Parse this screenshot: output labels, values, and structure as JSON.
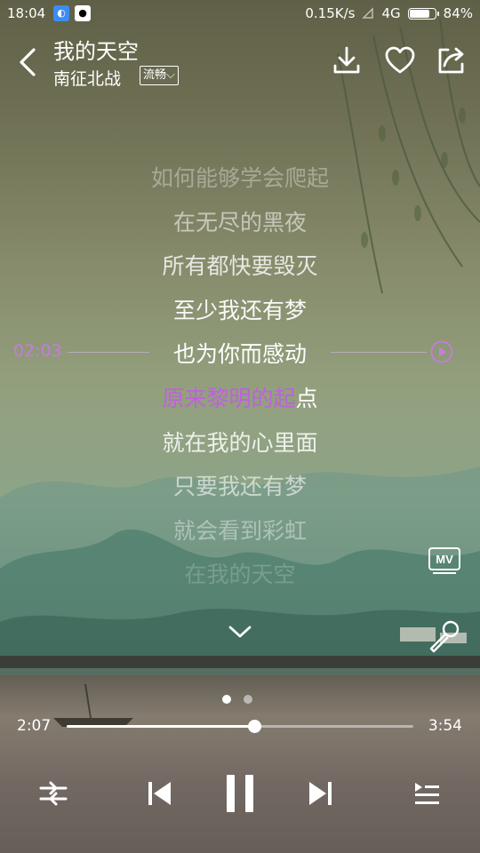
{
  "status_bar": {
    "time": "18:04",
    "network_speed": "0.15K/s",
    "network_type": "4G",
    "battery_percent": "84%",
    "battery_level": 0.84,
    "notification_icons": [
      "qq-browser-icon",
      "qq-penguin-icon"
    ]
  },
  "header": {
    "song_title": "我的天空",
    "artist": "南征北战",
    "quality": "流畅",
    "icons": [
      "back-icon",
      "download-icon",
      "heart-icon",
      "share-icon"
    ]
  },
  "lyrics": {
    "lines": [
      "如何能够学会爬起",
      "在无尽的黑夜",
      "所有都快要毁灭",
      "至少我还有梦",
      "也为你而感动",
      "原来黎明的起点",
      "就在我的心里面",
      "只要我还有梦",
      "就会看到彩虹",
      "在我的天空"
    ],
    "line_opacity": [
      0.35,
      0.55,
      0.8,
      0.95,
      1.0,
      1.0,
      0.85,
      0.6,
      0.4,
      0.2
    ],
    "active_line_index": 5,
    "sung_part": "原来黎明的起",
    "unsung_part": "点",
    "seek_marker_time": "02:03",
    "accent_color": "#c060df"
  },
  "mv_label": "MV",
  "pager": {
    "count": 2,
    "active": 0
  },
  "playback": {
    "current_time": "2:07",
    "total_time": "3:54",
    "progress": 0.54
  },
  "controls": [
    "shuffle-icon",
    "previous-icon",
    "pause-icon",
    "next-icon",
    "playlist-icon"
  ]
}
